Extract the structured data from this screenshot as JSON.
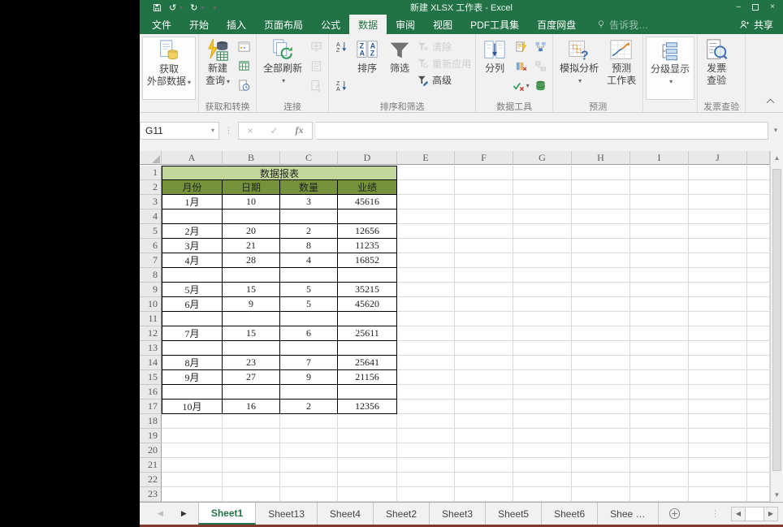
{
  "window": {
    "titlebar": {
      "title": "新建 XLSX 工作表 - Excel"
    },
    "tell_me": "告诉我…",
    "share_label": "共享"
  },
  "ribbon_tabs": [
    {
      "key": "file",
      "label": "文件"
    },
    {
      "key": "home",
      "label": "开始"
    },
    {
      "key": "insert",
      "label": "插入"
    },
    {
      "key": "page-layout",
      "label": "页面布局"
    },
    {
      "key": "formulas",
      "label": "公式"
    },
    {
      "key": "data",
      "label": "数据",
      "active": true
    },
    {
      "key": "review",
      "label": "审阅"
    },
    {
      "key": "view",
      "label": "视图"
    },
    {
      "key": "pdf-tools",
      "label": "PDF工具集"
    },
    {
      "key": "baidu-pan",
      "label": "百度网盘"
    }
  ],
  "ribbon_groups": [
    {
      "label": "",
      "cols": [
        {
          "kind": "big",
          "buttons": [
            {
              "name": "get-external-data",
              "icon": "get-external",
              "lines": [
                "获取",
                "外部数据"
              ],
              "dd": true,
              "boxed": true
            }
          ]
        }
      ]
    },
    {
      "label": "获取和转换",
      "cols": [
        {
          "kind": "big",
          "buttons": [
            {
              "name": "new-query",
              "icon": "new-query",
              "lines": [
                "新建",
                "查询"
              ],
              "dd": true
            }
          ]
        },
        {
          "kind": "small",
          "buttons": [
            {
              "name": "show-queries",
              "icon": "show-queries"
            },
            {
              "name": "from-table",
              "icon": "from-table"
            },
            {
              "name": "recent-sources",
              "icon": "recent-sources"
            }
          ]
        }
      ]
    },
    {
      "label": "连接",
      "cols": [
        {
          "kind": "big",
          "buttons": [
            {
              "name": "refresh-all",
              "icon": "refresh-all",
              "lines": [
                "全部刷新"
              ],
              "dd": "below"
            }
          ]
        },
        {
          "kind": "small",
          "buttons": [
            {
              "name": "connections",
              "icon": "connections",
              "disabled": true
            },
            {
              "name": "properties",
              "icon": "properties",
              "disabled": true
            },
            {
              "name": "edit-links",
              "icon": "edit-links",
              "disabled": true
            }
          ]
        }
      ]
    },
    {
      "label": "排序和筛选",
      "cols": [
        {
          "kind": "small",
          "buttons": [
            {
              "name": "sort-ascending",
              "icon": "sort-az"
            },
            {
              "name": "sort-descending",
              "icon": "sort-za"
            }
          ]
        },
        {
          "kind": "big",
          "buttons": [
            {
              "name": "sort",
              "icon": "sort-big",
              "lines": [
                "排序"
              ]
            }
          ]
        },
        {
          "kind": "big",
          "buttons": [
            {
              "name": "filter",
              "icon": "funnel",
              "lines": [
                "筛选"
              ]
            }
          ]
        },
        {
          "kind": "small-labeled",
          "buttons": [
            {
              "name": "clear-filter",
              "icon": "clear-filter",
              "label": "清除",
              "disabled": true
            },
            {
              "name": "reapply-filter",
              "icon": "reapply-filter",
              "label": "重新应用",
              "disabled": true
            },
            {
              "name": "advanced-filter",
              "icon": "advanced-filter",
              "label": "高级"
            }
          ]
        }
      ]
    },
    {
      "label": "数据工具",
      "cols": [
        {
          "kind": "big",
          "buttons": [
            {
              "name": "text-to-columns",
              "icon": "text-to-columns",
              "lines": [
                "分列"
              ]
            }
          ]
        },
        {
          "kind": "small",
          "buttons": [
            {
              "name": "flash-fill",
              "icon": "flash-fill"
            },
            {
              "name": "remove-duplicates",
              "icon": "remove-duplicates"
            },
            {
              "name": "data-validation",
              "icon": "data-validation",
              "dd": true
            }
          ]
        },
        {
          "kind": "small",
          "buttons": [
            {
              "name": "consolidate",
              "icon": "consolidate"
            },
            {
              "name": "relationships",
              "icon": "relationships",
              "disabled": true
            },
            {
              "name": "manage-data-model",
              "icon": "data-model"
            }
          ]
        }
      ]
    },
    {
      "label": "预测",
      "cols": [
        {
          "kind": "big",
          "buttons": [
            {
              "name": "what-if-analysis",
              "icon": "what-if",
              "lines": [
                "模拟分析"
              ],
              "dd": "below"
            }
          ]
        },
        {
          "kind": "big",
          "buttons": [
            {
              "name": "forecast-sheet",
              "icon": "forecast",
              "lines": [
                "预测",
                "工作表"
              ]
            }
          ]
        }
      ]
    },
    {
      "label": "",
      "cols": [
        {
          "kind": "big",
          "buttons": [
            {
              "name": "outline",
              "icon": "outline",
              "lines": [
                "分级显示"
              ],
              "dd": "below",
              "boxed": true
            }
          ]
        }
      ]
    },
    {
      "label": "发票查验",
      "cols": [
        {
          "kind": "big",
          "buttons": [
            {
              "name": "invoice-verify",
              "icon": "invoice-check",
              "lines": [
                "发票",
                "查验"
              ]
            }
          ]
        }
      ]
    }
  ],
  "formula_bar": {
    "name_box": "G11",
    "formula_value": "",
    "fx_label": "fx"
  },
  "grid": {
    "col_letters": [
      "A",
      "B",
      "C",
      "D",
      "E",
      "F",
      "G",
      "H",
      "I",
      "J"
    ],
    "row_count": 23,
    "table": {
      "title": "数据报表",
      "title_row": 1,
      "header_row": 2,
      "first_data_row": 3,
      "headers": [
        "月份",
        "日期",
        "数量",
        "业绩"
      ],
      "rows": [
        [
          "1月",
          "10",
          "3",
          "45616"
        ],
        [
          "",
          "",
          "",
          ""
        ],
        [
          "2月",
          "20",
          "2",
          "12656"
        ],
        [
          "3月",
          "21",
          "8",
          "11235"
        ],
        [
          "4月",
          "28",
          "4",
          "16852"
        ],
        [
          "",
          "",
          "",
          ""
        ],
        [
          "5月",
          "15",
          "5",
          "35215"
        ],
        [
          "6月",
          "9",
          "5",
          "45620"
        ],
        [
          "",
          "",
          "",
          ""
        ],
        [
          "7月",
          "15",
          "6",
          "25611"
        ],
        [
          "",
          "",
          "",
          ""
        ],
        [
          "8月",
          "23",
          "7",
          "25641"
        ],
        [
          "9月",
          "27",
          "9",
          "21156"
        ],
        [
          "",
          "",
          "",
          ""
        ],
        [
          "10月",
          "16",
          "2",
          "12356"
        ]
      ]
    }
  },
  "sheet_bar": {
    "tabs": [
      {
        "key": "Sheet1",
        "label": "Sheet1",
        "active": true
      },
      {
        "key": "Sheet13",
        "label": "Sheet13"
      },
      {
        "key": "Sheet4",
        "label": "Sheet4"
      },
      {
        "key": "Sheet2",
        "label": "Sheet2"
      },
      {
        "key": "Sheet3",
        "label": "Sheet3"
      },
      {
        "key": "Sheet5",
        "label": "Sheet5"
      },
      {
        "key": "Sheet6",
        "label": "Sheet6"
      },
      {
        "key": "Shee-truncated",
        "label": "Shee …"
      }
    ]
  },
  "glyphs": {
    "cancel": "×",
    "enter": "✓",
    "caret": "▾",
    "vdots": "⋮",
    "up": "▲",
    "down": "▼",
    "left": "◀",
    "right": "▶",
    "minimize": "–",
    "close": "×",
    "undo": "↺",
    "redo": "↻",
    "fchev": "▾"
  },
  "colors": {
    "accent": "#217346",
    "table_title_bg": "#c4d79b",
    "table_header_bg": "#76933c"
  }
}
